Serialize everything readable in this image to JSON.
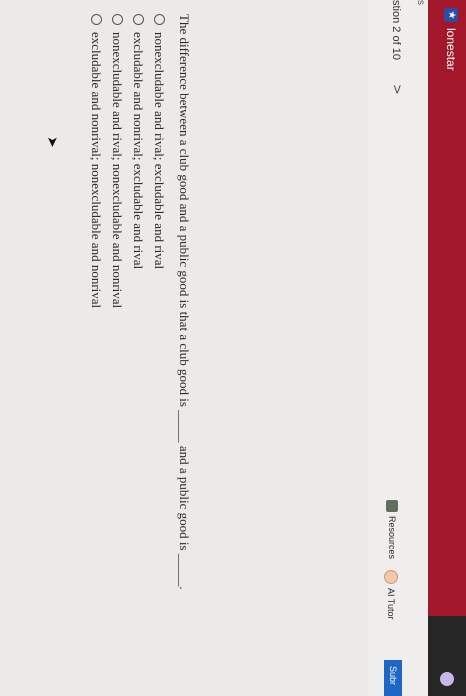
{
  "header": {
    "brand": "lonestar",
    "brand_icon": "star-icon"
  },
  "nav": {
    "crumb": "s",
    "question_count": "stion 2 of 10",
    "next_chevron": ">"
  },
  "toolbar": {
    "resources_label": "Resources",
    "ai_tutor_label": "AI Tutor",
    "submit_label": "Subr"
  },
  "question": {
    "text": "The difference between a club good and a public good is that a club good is _____ and a public good is _____.",
    "options": [
      "nonexcludable and rival; excludable and rival",
      "excludable and nonrival; excludable and rival",
      "nonexcludable and rival; nonexcludable and nonrival",
      "excludable and nonrival; nonexcludable and nonrival"
    ]
  },
  "colors": {
    "topbar": "#a3172a",
    "submit": "#1f67c6",
    "page_bg": "#eceae7"
  }
}
